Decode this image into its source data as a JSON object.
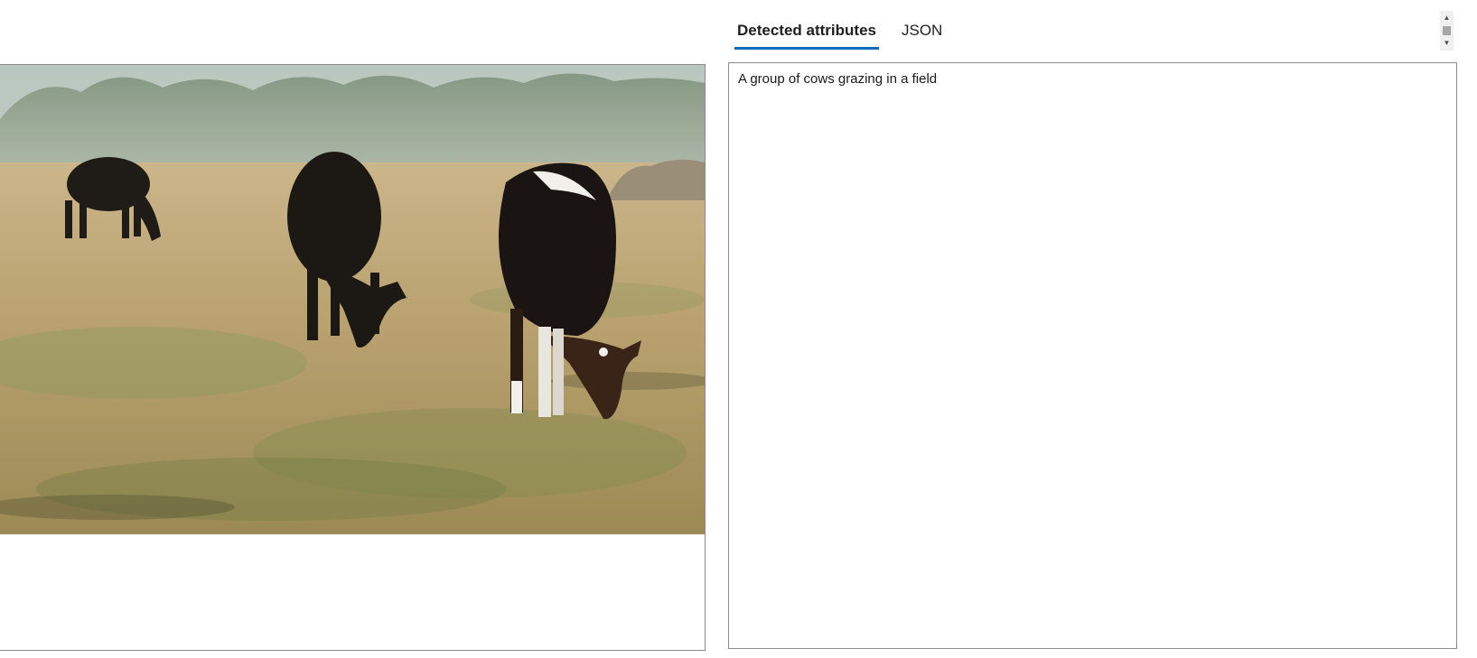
{
  "tabs": [
    {
      "label": "Detected attributes",
      "active": true
    },
    {
      "label": "JSON",
      "active": false
    }
  ],
  "result": {
    "caption": "A group of cows grazing in a field"
  },
  "scrollbar": {
    "up_icon": "▲",
    "down_icon": "▼"
  },
  "colors": {
    "accent": "#0f6cbd",
    "border": "#8a8a8a"
  }
}
